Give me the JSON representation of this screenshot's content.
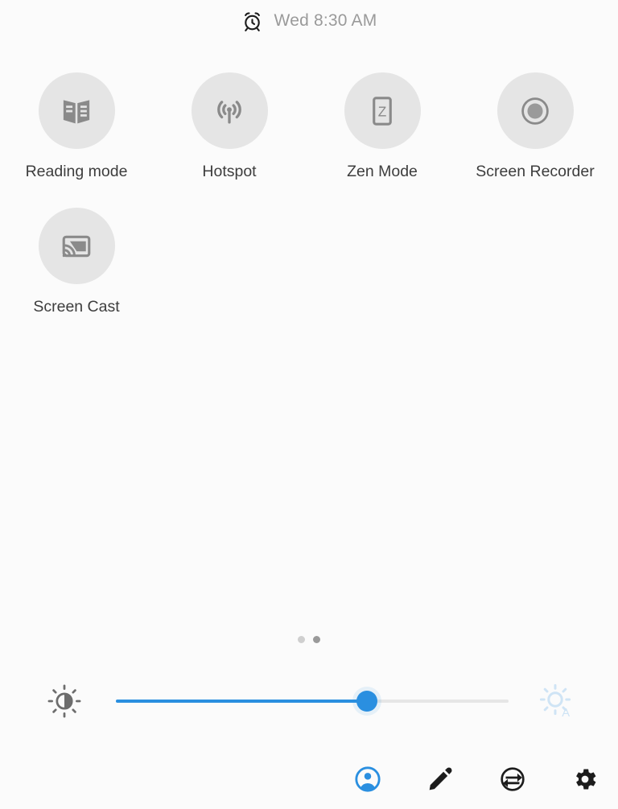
{
  "header": {
    "alarm_icon": "alarm-clock-icon",
    "time_text": "Wed 8:30 AM"
  },
  "tiles": [
    {
      "label": "Reading mode",
      "icon": "book-icon",
      "state": "off"
    },
    {
      "label": "Hotspot",
      "icon": "hotspot-icon",
      "state": "off"
    },
    {
      "label": "Zen Mode",
      "icon": "zen-mode-icon",
      "state": "off"
    },
    {
      "label": "Screen Recorder",
      "icon": "screen-recorder-icon",
      "state": "off"
    },
    {
      "label": "Screen Cast",
      "icon": "screen-cast-icon",
      "state": "off"
    }
  ],
  "pager": {
    "total_pages": 2,
    "current_page": 2
  },
  "brightness": {
    "low_icon": "brightness-low-icon",
    "auto_icon": "brightness-auto-icon",
    "value_percent": 64
  },
  "toolbar": {
    "items": [
      {
        "name": "user-account",
        "icon": "user-circle-icon",
        "color": "#2a8fe0"
      },
      {
        "name": "edit-tiles",
        "icon": "pencil-icon",
        "color": "#1c1c1c"
      },
      {
        "name": "data-usage",
        "icon": "data-usage-icon",
        "color": "#1c1c1c"
      },
      {
        "name": "settings",
        "icon": "gear-icon",
        "color": "#1c1c1c"
      }
    ]
  },
  "colors": {
    "background": "#fbfbfb",
    "tile_circle": "#e5e5e5",
    "tile_icon": "#8a8a8a",
    "label_text": "#3d3d3d",
    "accent_blue": "#2a8fe0",
    "auto_icon_blue": "#cfe4f5"
  }
}
